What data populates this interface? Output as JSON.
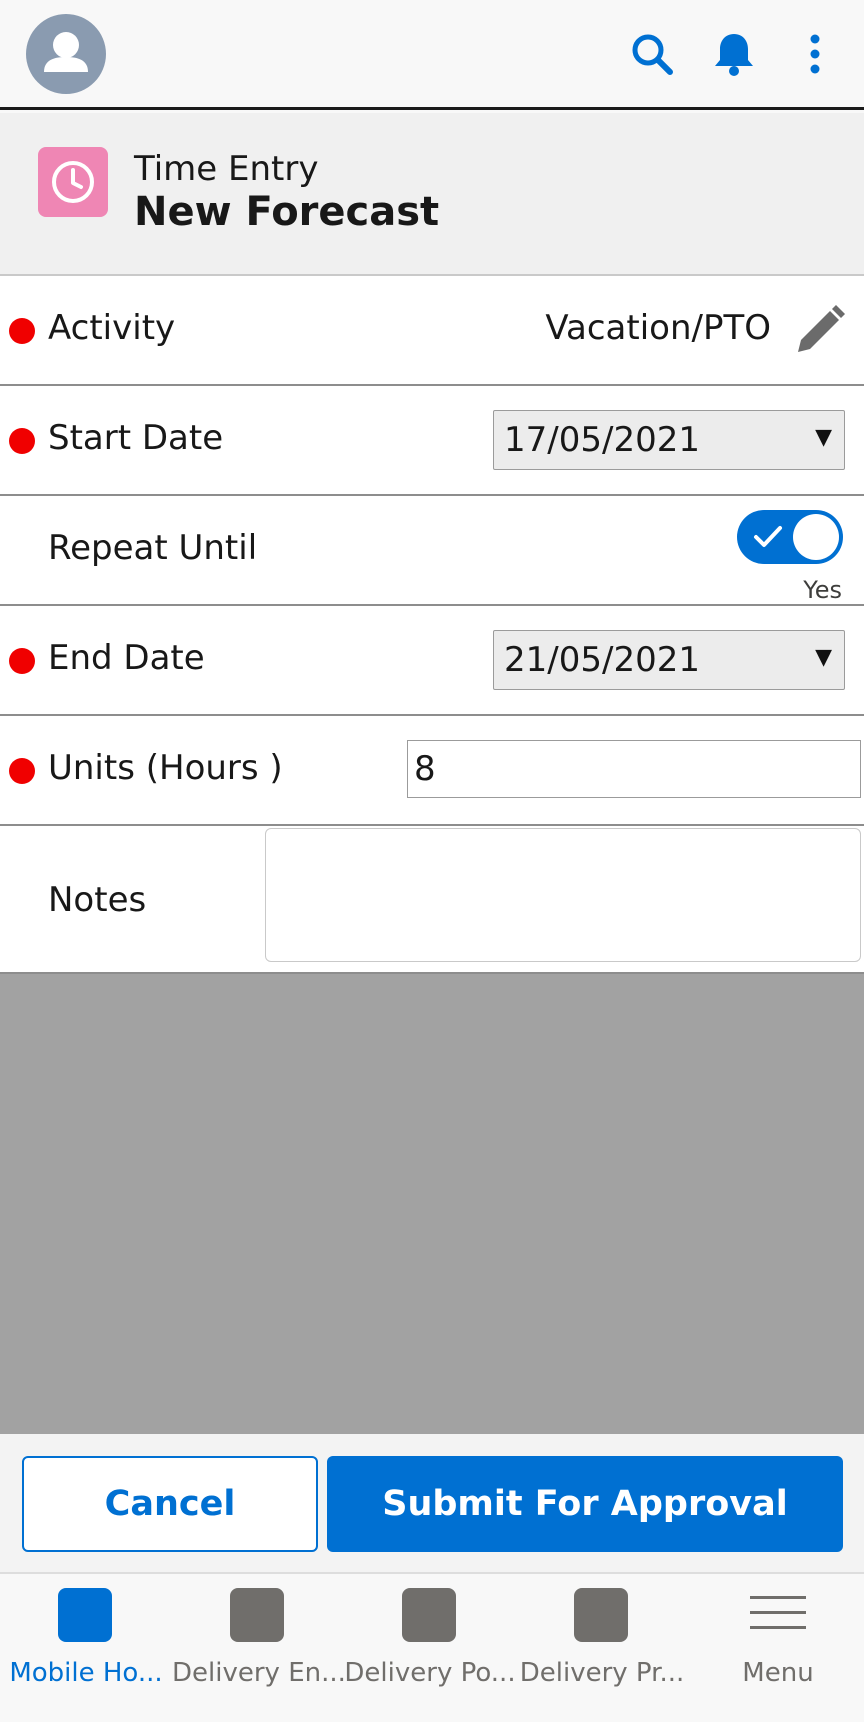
{
  "topbar": {
    "icons": [
      "avatar-icon",
      "search-icon",
      "bell-icon",
      "more-vertical-icon"
    ],
    "accent": "#0070d2"
  },
  "header": {
    "object_name": "Time Entry",
    "title": "New Forecast",
    "icon": "clock-icon",
    "icon_color": "#ef86b4"
  },
  "form": {
    "activity": {
      "label": "Activity",
      "value": "Vacation/PTO",
      "required": true
    },
    "start_date": {
      "label": "Start Date",
      "value": "17/05/2021",
      "required": true
    },
    "repeat_until": {
      "label": "Repeat Until",
      "checked": true,
      "caption": "Yes"
    },
    "end_date": {
      "label": "End Date",
      "value": "21/05/2021",
      "required": true
    },
    "units": {
      "label": "Units (Hours )",
      "value": "8",
      "required": true
    },
    "notes": {
      "label": "Notes",
      "value": ""
    }
  },
  "footer": {
    "cancel_label": "Cancel",
    "submit_label": "Submit For Approval"
  },
  "nav": {
    "items": [
      {
        "label": "Mobile Ho...",
        "active": true
      },
      {
        "label": "Delivery En...",
        "active": false
      },
      {
        "label": "Delivery Po...",
        "active": false
      },
      {
        "label": "Delivery Pr...",
        "active": false
      },
      {
        "label": "Menu",
        "active": false
      }
    ]
  },
  "colors": {
    "required_dot": "#f00000",
    "primary": "#0070d2",
    "gray_area": "#a2a2a2"
  }
}
